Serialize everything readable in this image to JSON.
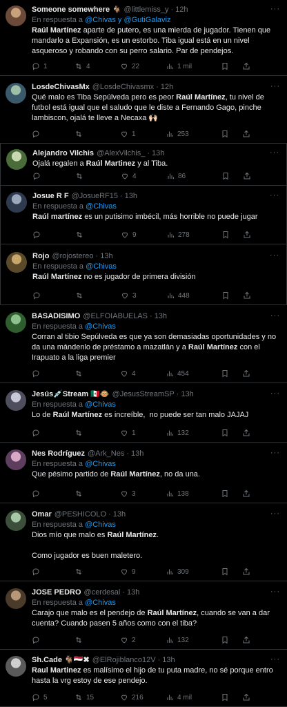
{
  "tweets": [
    {
      "name": "Someone somewhere",
      "badge": "🐐",
      "handle": "@littlemiss_y",
      "time": "12h",
      "reply_prefix": "En respuesta a ",
      "reply_to": "@Chivas y @GutiGalaviz",
      "text_parts": [
        {
          "b": "Raúl Martínez"
        },
        {
          "t": " aparte de putero, es una mierda de jugador. Tienen que mandarlo a Expansión, es un estorbo. Tiba igual está en un nivel asqueroso y robando con su perro salario. Par de pendejos."
        }
      ],
      "replies": "1",
      "retweets": "4",
      "likes": "22",
      "views": "1 mil"
    },
    {
      "name": "LosdeChivasMx",
      "handle": "@LosdeChivasmx",
      "time": "12h",
      "text_parts": [
        {
          "t": "Qué malo es Tiba Sepúlveda pero es peor "
        },
        {
          "b": "Raúl Martínez"
        },
        {
          "t": ", tu nivel de futbol está igual que el saludo que le diste a Fernando Gago, pinche lambiscon, ojalá te lleve a Necaxa 🙌🏻"
        }
      ],
      "replies": "",
      "retweets": "",
      "likes": "1",
      "views": "253"
    },
    {
      "name": "Alejandro Vilchis",
      "handle": "@AlexVilchis_",
      "time": "13h",
      "text_parts": [
        {
          "t": "Ojalá regalen a "
        },
        {
          "b": "Raúl Martinez"
        },
        {
          "t": " y al Tiba."
        }
      ],
      "replies": "",
      "retweets": "",
      "likes": "4",
      "views": "86"
    },
    {
      "name": "Josue R F",
      "handle": "@JosueRF15",
      "time": "13h",
      "reply_prefix": "En respuesta a ",
      "reply_to": "@Chivas",
      "text_parts": [
        {
          "b": "Raúl martínez"
        },
        {
          "t": " es un putisimo imbécil, más horrible no puede jugar"
        }
      ],
      "replies": "",
      "retweets": "",
      "likes": "9",
      "views": "278"
    },
    {
      "name": "Rojo",
      "handle": "@rojostereo",
      "time": "13h",
      "reply_prefix": "En respuesta a ",
      "reply_to": "@Chivas",
      "text_parts": [
        {
          "b": "Raúl Martínez"
        },
        {
          "t": " no es jugador de primera división"
        }
      ],
      "replies": "",
      "retweets": "",
      "likes": "3",
      "views": "448"
    },
    {
      "name": "BASADISIMO",
      "handle": "@ELFOIABUELAS",
      "time": "13h",
      "reply_prefix": "En respuesta a ",
      "reply_to": "@Chivas",
      "text_parts": [
        {
          "t": "Corran al tibio Sepúlveda es que ya son demasiadas oportunidades y no da una mándenlo de préstamo a mazatlán y a "
        },
        {
          "b": "Raúl Martínez"
        },
        {
          "t": " con el Irapuato a la liga premier"
        }
      ],
      "replies": "",
      "retweets": "",
      "likes": "4",
      "views": "454"
    },
    {
      "name": "Jesús💉Stream 🇲🇽🐵",
      "handle": "@JesusStreamSP",
      "time": "13h",
      "reply_prefix": "En respuesta a ",
      "reply_to": "@Chivas",
      "text_parts": [
        {
          "t": "Lo de "
        },
        {
          "b": "Raúl Martínez"
        },
        {
          "t": " es increíble,  no puede ser tan malo JAJAJ"
        }
      ],
      "replies": "",
      "retweets": "",
      "likes": "1",
      "views": "132"
    },
    {
      "name": "Nes Rodríguez",
      "handle": "@Ark_Nes",
      "time": "13h",
      "reply_prefix": "En respuesta a ",
      "reply_to": "@Chivas",
      "text_parts": [
        {
          "t": "Que pésimo partido de "
        },
        {
          "b": "Raúl Martínez"
        },
        {
          "t": ", no da una."
        }
      ],
      "replies": "",
      "retweets": "",
      "likes": "3",
      "views": "138"
    },
    {
      "name": "Omar",
      "handle": "@PESHICOLO",
      "time": "13h",
      "reply_prefix": "En respuesta a ",
      "reply_to": "@Chivas",
      "text_parts": [
        {
          "t": "Dios mío que malo es "
        },
        {
          "b": "Raúl Martínez"
        },
        {
          "t": ".\n\nComo jugador es buen maletero."
        }
      ],
      "replies": "",
      "retweets": "",
      "likes": "9",
      "views": "309"
    },
    {
      "name": "JOSE PEDRO",
      "handle": "@cerdesal",
      "time": "13h",
      "reply_prefix": "En respuesta a ",
      "reply_to": "@Chivas",
      "text_parts": [
        {
          "t": "Carajo que malo es el pendejo de "
        },
        {
          "b": "Raúl Martínez"
        },
        {
          "t": ", cuando se van a dar cuenta? Cuando pasen 5 años como con el tiba?"
        }
      ],
      "replies": "",
      "retweets": "",
      "likes": "2",
      "views": "132"
    },
    {
      "name": "Sh.Cade 🐐🇾🇪✖",
      "handle": "@ElRojiblanco12V",
      "time": "13h",
      "text_parts": [
        {
          "b": "Raul Martinez"
        },
        {
          "t": " es malísimo el hijo de tu puta madre, no sé porque entro hasta la vrg estoy de ese pendejo."
        }
      ],
      "replies": "5",
      "retweets": "15",
      "likes": "216",
      "views": "4 mil"
    }
  ],
  "colors": {
    "background": "#000000",
    "text": "#e7e9ea",
    "muted": "#71767b",
    "link": "#1d9bf0",
    "divider": "#2f3336"
  },
  "icons": [
    "reply-icon",
    "retweet-icon",
    "like-icon",
    "views-icon",
    "bookmark-icon",
    "share-icon",
    "more-icon"
  ]
}
